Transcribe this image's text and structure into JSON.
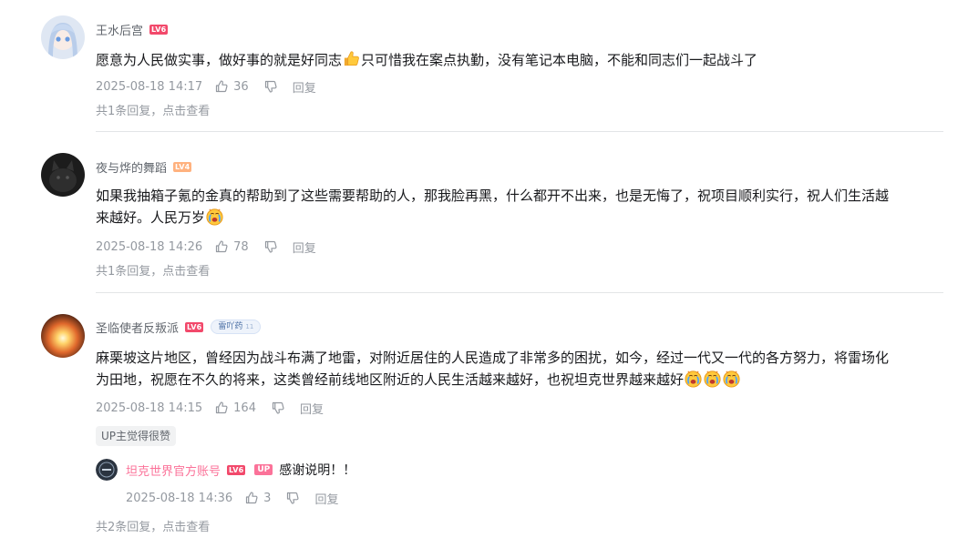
{
  "comments": [
    {
      "username": "王水后宫",
      "level": "LV6",
      "text_before_emoji": "愿意为人民做实事，做好事的就是好同志",
      "emoji": "thumbs-up-emoji",
      "text_after_emoji": "只可惜我在案点执勤，没有笔记本电脑，不能和同志们一起战斗了",
      "time": "2025-08-18 14:17",
      "likes": "36",
      "reply_label": "回复",
      "more_text": "共1条回复，",
      "more_link": "点击查看"
    },
    {
      "username": "夜与烨的舞蹈",
      "level": "LV4",
      "text_line1": "如果我抽箱子氪的金真的帮助到了这些需要帮助的人，那我脸再黑，什么都开不出来，也是无悔了，祝项目顺利实行，祝人们生活越",
      "text_line2": "来越好。人民万岁",
      "emoji": "crying-emoji",
      "time": "2025-08-18 14:26",
      "likes": "78",
      "reply_label": "回复",
      "more_text": "共1条回复，",
      "more_link": "点击查看"
    },
    {
      "username": "圣临使者反叛派",
      "level": "LV6",
      "medal_name": "雷吖药",
      "medal_level": "11",
      "text_line1": "麻栗坡这片地区，曾经因为战斗布满了地雷，对附近居住的人民造成了非常多的困扰，如今，经过一代又一代的各方努力，将雷场化",
      "text_line2": "为田地，祝愿在不久的将来，这类曾经前线地区附近的人民生活越来越好，也祝坦克世界越来越好",
      "emoji": "crying-emoji",
      "time": "2025-08-18 14:15",
      "likes": "164",
      "reply_label": "回复",
      "up_tag": "UP主觉得很赞",
      "reply": {
        "username": "坦克世界官方账号",
        "level": "LV6",
        "up_badge": "UP",
        "text": "感谢说明！！",
        "time": "2025-08-18 14:36",
        "likes": "3",
        "reply_label": "回复"
      },
      "more_text": "共2条回复，",
      "more_link": "点击查看"
    }
  ],
  "colors": {
    "accent_pink": "#fb7299",
    "level6": "#f2496b",
    "level4": "#ffb27f",
    "meta_gray": "#9499a0"
  }
}
